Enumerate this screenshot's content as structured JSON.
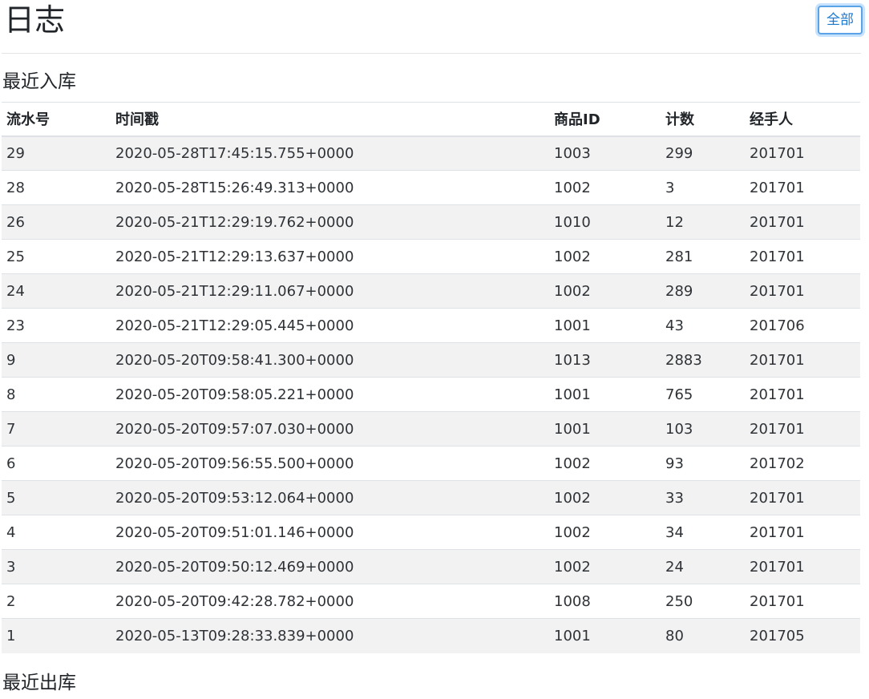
{
  "header": {
    "title": "日志",
    "all_button_label": "全部"
  },
  "recent_in": {
    "heading": "最近入库",
    "columns": [
      "流水号",
      "时间戳",
      "商品ID",
      "计数",
      "经手人"
    ],
    "rows": [
      [
        "29",
        "2020-05-28T17:45:15.755+0000",
        "1003",
        "299",
        "201701"
      ],
      [
        "28",
        "2020-05-28T15:26:49.313+0000",
        "1002",
        "3",
        "201701"
      ],
      [
        "26",
        "2020-05-21T12:29:19.762+0000",
        "1010",
        "12",
        "201701"
      ],
      [
        "25",
        "2020-05-21T12:29:13.637+0000",
        "1002",
        "281",
        "201701"
      ],
      [
        "24",
        "2020-05-21T12:29:11.067+0000",
        "1002",
        "289",
        "201701"
      ],
      [
        "23",
        "2020-05-21T12:29:05.445+0000",
        "1001",
        "43",
        "201706"
      ],
      [
        "9",
        "2020-05-20T09:58:41.300+0000",
        "1013",
        "2883",
        "201701"
      ],
      [
        "8",
        "2020-05-20T09:58:05.221+0000",
        "1001",
        "765",
        "201701"
      ],
      [
        "7",
        "2020-05-20T09:57:07.030+0000",
        "1001",
        "103",
        "201701"
      ],
      [
        "6",
        "2020-05-20T09:56:55.500+0000",
        "1002",
        "93",
        "201702"
      ],
      [
        "5",
        "2020-05-20T09:53:12.064+0000",
        "1002",
        "33",
        "201701"
      ],
      [
        "4",
        "2020-05-20T09:51:01.146+0000",
        "1002",
        "34",
        "201701"
      ],
      [
        "3",
        "2020-05-20T09:50:12.469+0000",
        "1002",
        "24",
        "201701"
      ],
      [
        "2",
        "2020-05-20T09:42:28.782+0000",
        "1008",
        "250",
        "201701"
      ],
      [
        "1",
        "2020-05-13T09:28:33.839+0000",
        "1001",
        "80",
        "201705"
      ]
    ]
  },
  "recent_out": {
    "heading": "最近出库"
  },
  "colors": {
    "accent": "#1d78d0",
    "stripe": "#f2f2f2",
    "border": "#dee2e6"
  }
}
